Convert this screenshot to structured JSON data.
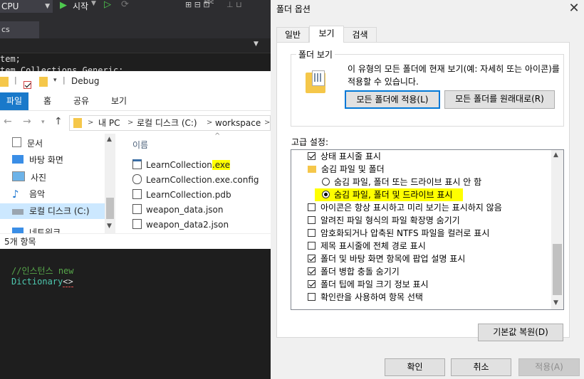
{
  "vs": {
    "cpu": "CPU",
    "start": "시작",
    "tab": "cs",
    "code_lines": [
      "tem;",
      "tem.Collections.Generic;"
    ],
    "comment": "//인스턴스 new",
    "dictionary": "Dictionary",
    "generic": "<>"
  },
  "explorer": {
    "title": "Debug",
    "ribbon": {
      "file": "파일",
      "home": "홈",
      "share": "공유",
      "view": "보기"
    },
    "address": [
      "내 PC",
      "로컬 디스크 (C:)",
      "workspace"
    ],
    "sidebar": [
      {
        "label": "문서",
        "icon": "document-icon"
      },
      {
        "label": "바탕 화면",
        "icon": "desktop-icon"
      },
      {
        "label": "사진",
        "icon": "pictures-icon"
      },
      {
        "label": "음악",
        "icon": "music-icon"
      },
      {
        "label": "로컬 디스크 (C:)",
        "icon": "drive-icon"
      },
      {
        "label": "네트워크",
        "icon": "network-icon"
      }
    ],
    "column_name": "이름",
    "files": [
      {
        "name": "LearnCollection",
        "ext": ".exe"
      },
      {
        "name": "LearnCollection.exe.config",
        "ext": ""
      },
      {
        "name": "LearnCollection.pdb",
        "ext": ""
      },
      {
        "name": "weapon_data.json",
        "ext": ""
      },
      {
        "name": "weapon_data2.json",
        "ext": ""
      }
    ],
    "status": "5개 항목"
  },
  "dialog": {
    "title": "폴더 옵션",
    "tabs": [
      "일반",
      "보기",
      "검색"
    ],
    "group_title": "폴더 보기",
    "group_desc": "이 유형의 모든 폴더에 현재 보기(예: 자세히 또는 아이콘)를 적용할 수 있습니다.",
    "btn_apply_all": "모든 폴더에 적용(L)",
    "btn_reset_folders": "모든 폴더를 원래대로(R)",
    "advanced_label": "고급 설정:",
    "items": [
      {
        "type": "checkbox",
        "checked": true,
        "label": "상태 표시줄 표시"
      },
      {
        "type": "folder",
        "label": "숨김 파일 및 폴더"
      },
      {
        "type": "radio",
        "checked": false,
        "label": "숨김 파일, 폴더 또는 드라이브 표시 안 함"
      },
      {
        "type": "radio",
        "checked": true,
        "label": "숨김 파일, 폴더 및 드라이브 표시",
        "highlight": true
      },
      {
        "type": "checkbox",
        "checked": false,
        "label": "아이콘은 항상 표시하고 미리 보기는 표시하지 않음"
      },
      {
        "type": "checkbox",
        "checked": false,
        "label": "알려진 파일 형식의 파일 확장명 숨기기"
      },
      {
        "type": "checkbox",
        "checked": false,
        "label": "암호화되거나 압축된 NTFS 파일을 컬러로 표시"
      },
      {
        "type": "checkbox",
        "checked": false,
        "label": "제목 표시줄에 전체 경로 표시"
      },
      {
        "type": "checkbox",
        "checked": true,
        "label": "폴더 및 바탕 화면 항목에 팝업 설명 표시"
      },
      {
        "type": "checkbox",
        "checked": true,
        "label": "폴더 병합 충돌 숨기기"
      },
      {
        "type": "checkbox",
        "checked": true,
        "label": "폴더 팁에 파일 크기 정보 표시"
      },
      {
        "type": "checkbox",
        "checked": false,
        "label": "확인란을 사용하여 항목 선택"
      }
    ],
    "btn_restore": "기본값 복원(D)",
    "btn_ok": "확인",
    "btn_cancel": "취소",
    "btn_apply": "적용(A)"
  },
  "colors": {
    "highlight": "#ffff00",
    "accent": "#0078d7",
    "ribbon_file": "#1979ca"
  }
}
